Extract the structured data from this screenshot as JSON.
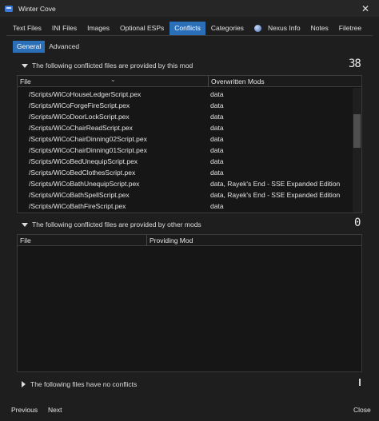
{
  "window": {
    "title": "Winter Cove",
    "close": "✕"
  },
  "tabs": [
    {
      "label": "Text Files"
    },
    {
      "label": "INI Files"
    },
    {
      "label": "Images"
    },
    {
      "label": "Optional ESPs"
    },
    {
      "label": "Conflicts",
      "active": true
    },
    {
      "label": "Categories"
    },
    {
      "label": "Nexus Info",
      "icon": "globe-icon"
    },
    {
      "label": "Notes"
    },
    {
      "label": "Filetree"
    }
  ],
  "subtabs": [
    {
      "label": "General",
      "active": true
    },
    {
      "label": "Advanced"
    }
  ],
  "section1": {
    "title": "The following conflicted files are provided by this mod",
    "count": "38",
    "columns": {
      "file": "File",
      "mods": "Overwritten Mods"
    },
    "rows": [
      {
        "file": "/Scripts/WiCoHouseLedgerScript.pex",
        "mods": "data"
      },
      {
        "file": "/Scripts/WiCoForgeFireScript.pex",
        "mods": "data"
      },
      {
        "file": "/Scripts/WiCoDoorLockScript.pex",
        "mods": "data"
      },
      {
        "file": "/Scripts/WiCoChairReadScript.pex",
        "mods": "data"
      },
      {
        "file": "/Scripts/WiCoChairDinning02Script.pex",
        "mods": "data"
      },
      {
        "file": "/Scripts/WiCoChairDinning01Script.pex",
        "mods": "data"
      },
      {
        "file": "/Scripts/WiCoBedUnequipScript.pex",
        "mods": "data"
      },
      {
        "file": "/Scripts/WiCoBedClothesScript.pex",
        "mods": "data"
      },
      {
        "file": "/Scripts/WiCoBathUnequipScript.pex",
        "mods": "data, Rayek's End - SSE Expanded Edition"
      },
      {
        "file": "/Scripts/WiCoBathSpellScript.pex",
        "mods": "data, Rayek's End - SSE Expanded Edition"
      },
      {
        "file": "/Scripts/WiCoBathFireScript.pex",
        "mods": "data"
      }
    ]
  },
  "section2": {
    "title": "The following conflicted files are provided by other mods",
    "count": "0",
    "columns": {
      "file": "File",
      "mods": "Providing Mod"
    }
  },
  "section3": {
    "title": "The following files have no conflicts"
  },
  "footer": {
    "previous": "Previous",
    "next": "Next",
    "close": "Close"
  }
}
